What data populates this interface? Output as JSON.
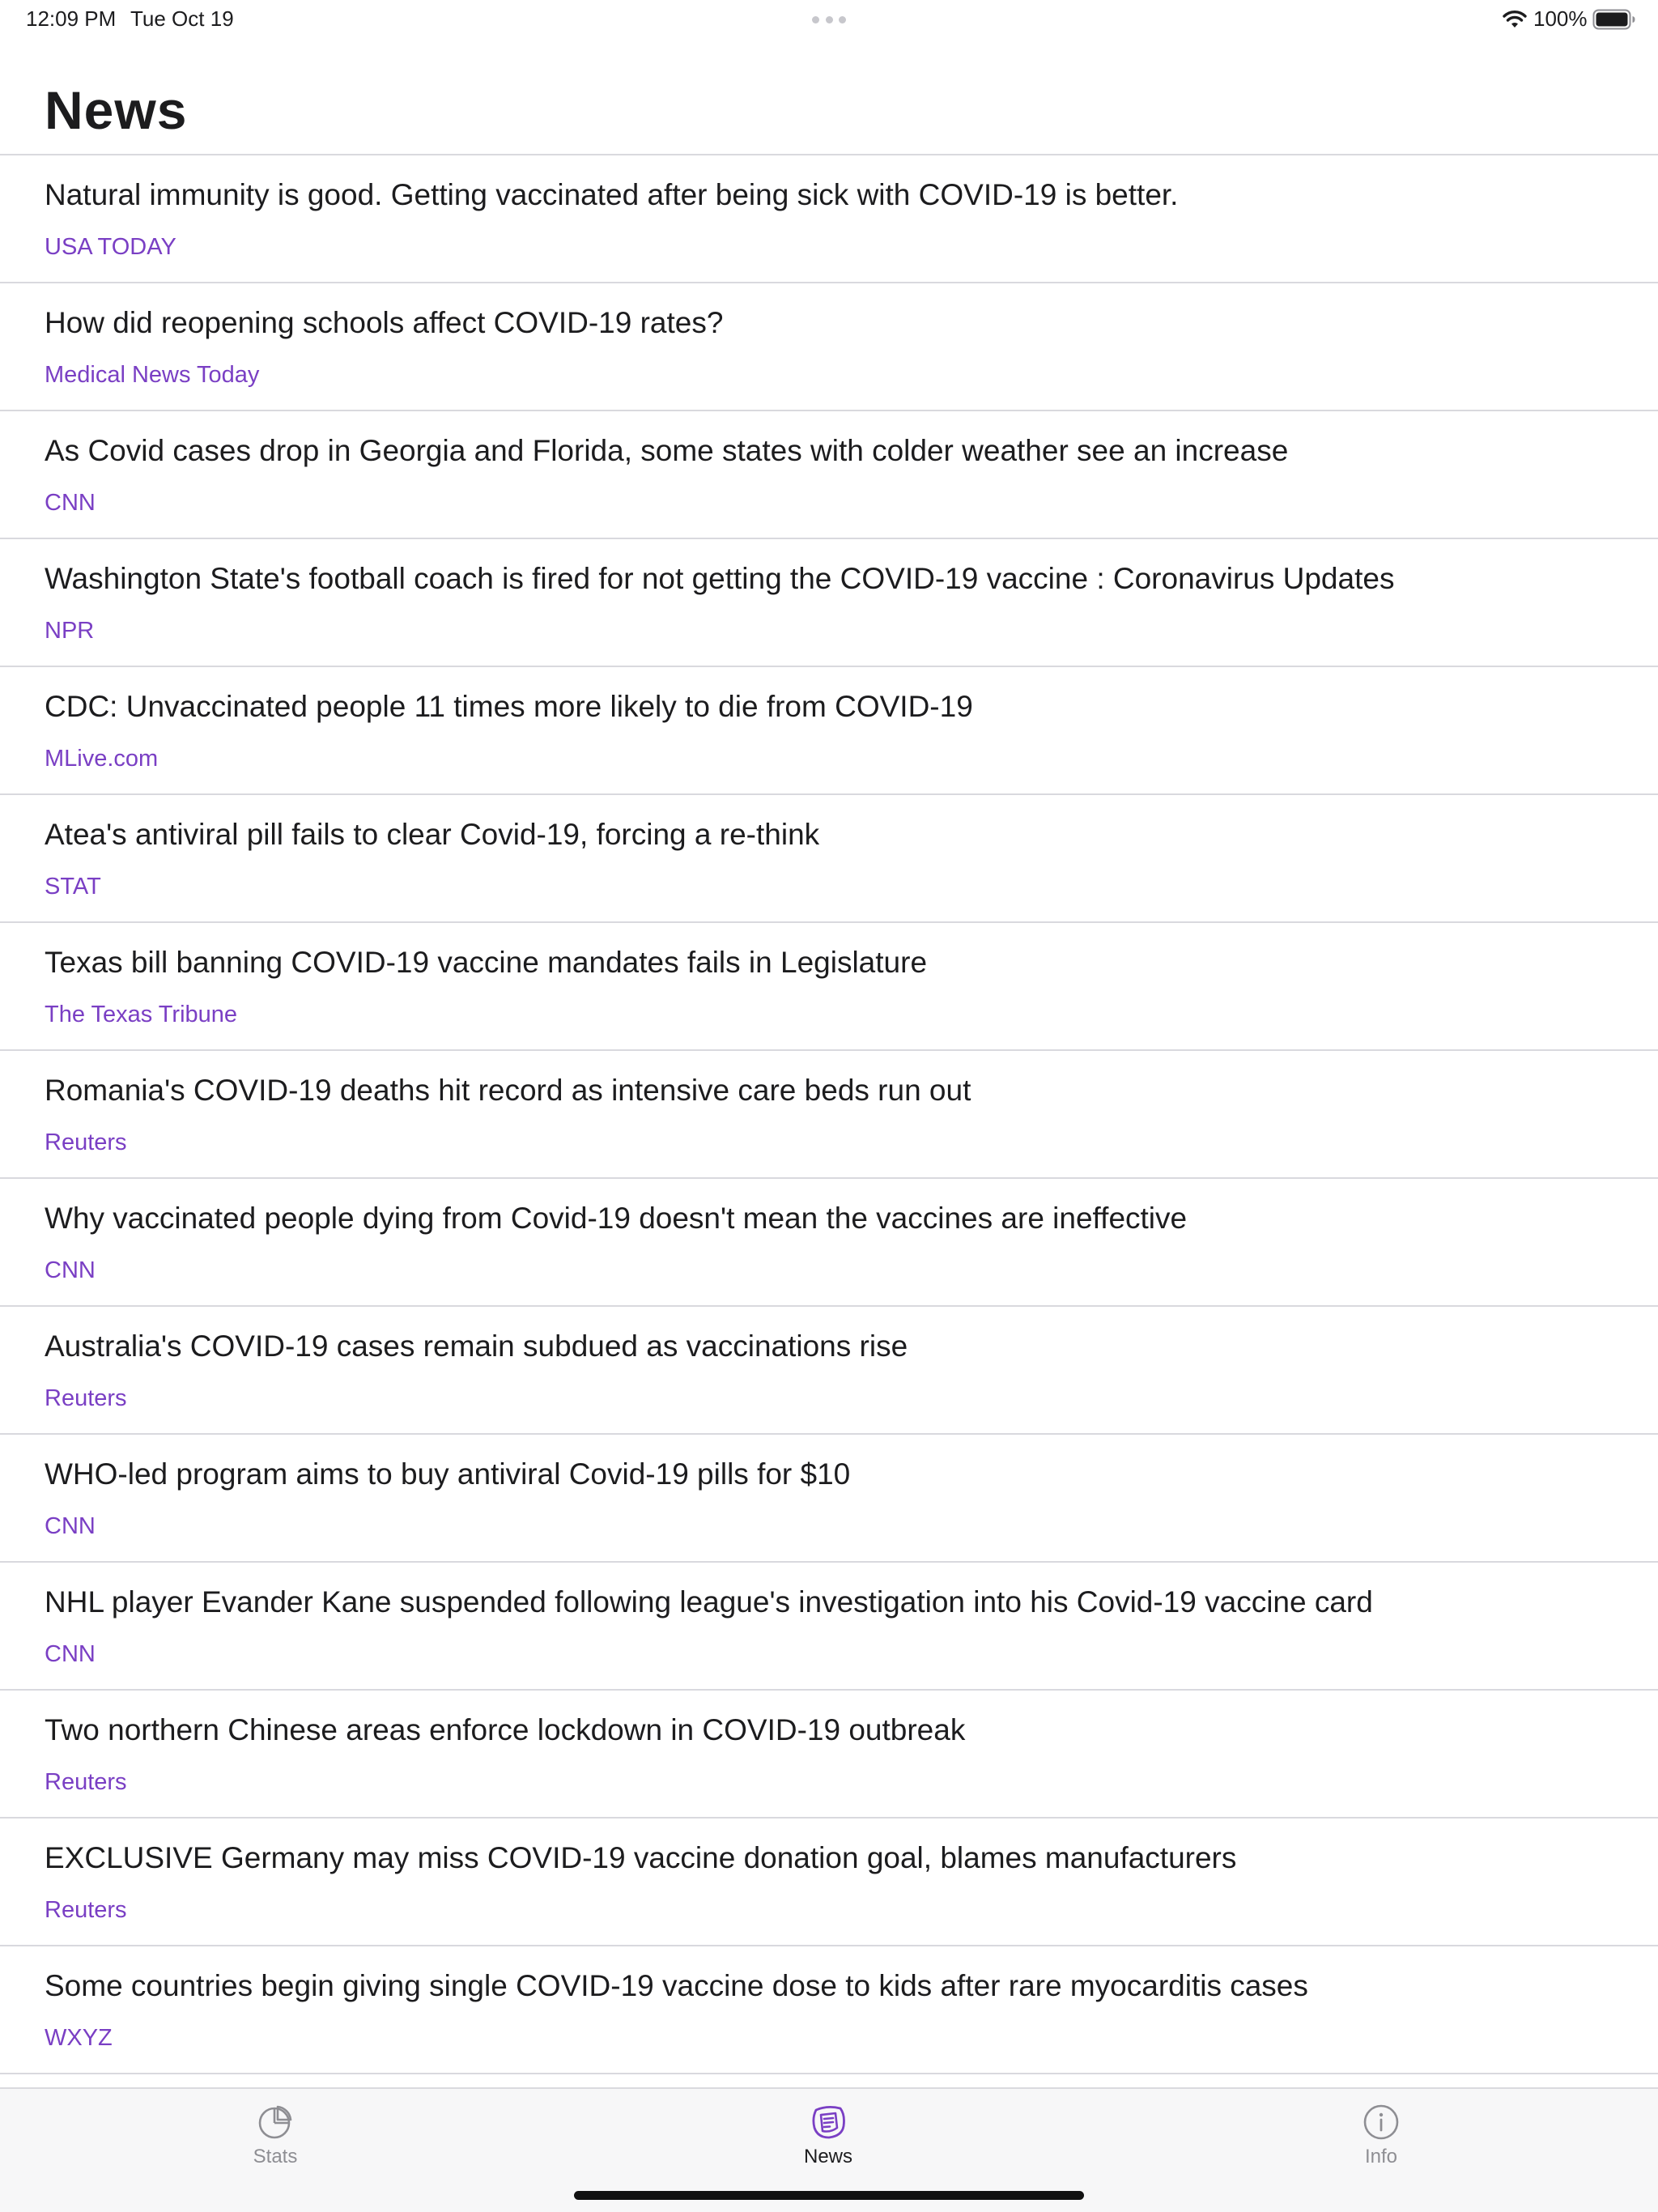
{
  "status_bar": {
    "time": "12:09 PM",
    "date": "Tue Oct 19",
    "battery": "100%"
  },
  "page": {
    "title": "News"
  },
  "news": [
    {
      "headline": "Natural immunity is good. Getting vaccinated after being sick with COVID-19 is better.",
      "source": "USA TODAY"
    },
    {
      "headline": "How did reopening schools affect COVID-19 rates?",
      "source": "Medical News Today"
    },
    {
      "headline": "As Covid cases drop in Georgia and Florida, some states with colder weather see an increase",
      "source": "CNN"
    },
    {
      "headline": "Washington State's football coach is fired for not getting the COVID-19 vaccine : Coronavirus Updates",
      "source": "NPR"
    },
    {
      "headline": "CDC: Unvaccinated people 11 times more likely to die from COVID-19",
      "source": "MLive.com"
    },
    {
      "headline": "Atea's antiviral pill fails to clear Covid-19, forcing a re-think",
      "source": "STAT"
    },
    {
      "headline": "Texas bill banning COVID-19 vaccine mandates fails in Legislature",
      "source": "The Texas Tribune"
    },
    {
      "headline": "Romania's COVID-19 deaths hit record as intensive care beds run out",
      "source": "Reuters"
    },
    {
      "headline": "Why vaccinated people dying from Covid-19 doesn't mean the vaccines are ineffective",
      "source": "CNN"
    },
    {
      "headline": "Australia's COVID-19 cases remain subdued as vaccinations rise",
      "source": "Reuters"
    },
    {
      "headline": "WHO-led program aims to buy antiviral Covid-19 pills for $10",
      "source": "CNN"
    },
    {
      "headline": "NHL player Evander Kane suspended following league's investigation into his Covid-19 vaccine card",
      "source": "CNN"
    },
    {
      "headline": "Two northern Chinese areas enforce lockdown in COVID-19 outbreak",
      "source": "Reuters"
    },
    {
      "headline": "EXCLUSIVE Germany may miss COVID-19 vaccine donation goal, blames manufacturers",
      "source": "Reuters"
    },
    {
      "headline": "Some countries begin giving single COVID-19 vaccine dose to kids after rare myocarditis cases",
      "source": "WXYZ"
    }
  ],
  "tab_bar": {
    "tabs": [
      {
        "label": "Stats",
        "icon": "pie-chart-icon",
        "active": false
      },
      {
        "label": "News",
        "icon": "newspaper-icon",
        "active": true
      },
      {
        "label": "Info",
        "icon": "info-icon",
        "active": false
      }
    ]
  },
  "colors": {
    "accent": "#7a3fc4",
    "text": "#1c1c1e",
    "inactive_tab": "#8e8e93",
    "divider": "#d9d9de"
  }
}
